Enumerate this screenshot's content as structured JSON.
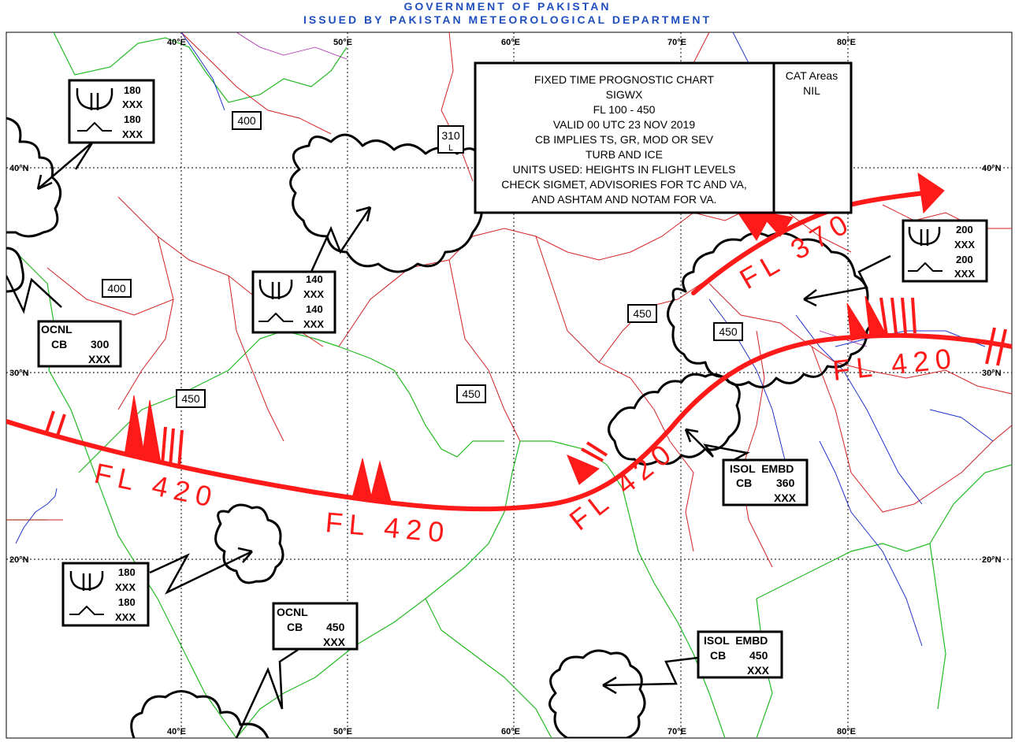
{
  "header": {
    "line1": "GOVERNMENT OF PAKISTAN",
    "line2": "ISSUED BY PAKISTAN METEOROLOGICAL DEPARTMENT"
  },
  "info_box": {
    "lines": [
      "FIXED TIME PROGNOSTIC CHART",
      "SIGWX",
      "FL 100 - 450",
      "VALID 00 UTC 23 NOV 2019",
      "CB IMPLIES TS, GR, MOD OR SEV",
      "TURB AND ICE",
      "UNITS USED: HEIGHTS IN FLIGHT LEVELS",
      "CHECK SIGMET, ADVISORIES FOR TC AND VA,",
      "AND ASHTAM AND NOTAM FOR VA."
    ]
  },
  "cat_box": {
    "title": "CAT Areas",
    "value": "NIL"
  },
  "graticule": {
    "lon_labels_top": [
      "40°E",
      "50°E",
      "60°E",
      "70°E",
      "80°E"
    ],
    "lon_labels_bottom": [
      "40°E",
      "50°E",
      "60°E",
      "70°E",
      "80°E"
    ],
    "lat_labels_left": [
      "40°N",
      "30°N",
      "20°N"
    ],
    "lat_labels_right": [
      "40°N",
      "30°N",
      "20°N"
    ]
  },
  "tropopause_heights": [
    "400",
    "310",
    "400",
    "450",
    "450",
    "450",
    "450"
  ],
  "tropopause_low_marker": "L",
  "jet_streams": [
    {
      "label": "FL 420"
    },
    {
      "label": "FL 420"
    },
    {
      "label": "FL 420"
    },
    {
      "label": "FL 420"
    },
    {
      "label": "FL 370"
    }
  ],
  "icing_turb_boxes": [
    {
      "turb_top": "180",
      "turb_base": "XXX",
      "ice_top": "180",
      "ice_base": "XXX"
    },
    {
      "turb_top": "140",
      "turb_base": "XXX",
      "ice_top": "140",
      "ice_base": "XXX"
    },
    {
      "turb_top": "180",
      "turb_base": "XXX",
      "ice_top": "180",
      "ice_base": "XXX"
    },
    {
      "turb_top": "200",
      "turb_base": "XXX",
      "ice_top": "200",
      "ice_base": "XXX"
    }
  ],
  "cb_boxes": [
    {
      "coverage": "OCNL",
      "type": "CB",
      "top": "300",
      "base": "XXX"
    },
    {
      "coverage": "ISOL  EMBD",
      "type": "CB",
      "top": "360",
      "base": "XXX"
    },
    {
      "coverage": "OCNL",
      "type": "CB",
      "top": "450",
      "base": "XXX"
    },
    {
      "coverage": "ISOL  EMBD",
      "type": "CB",
      "top": "450",
      "base": "XXX"
    }
  ],
  "colors": {
    "jet": "#ff1a1a",
    "border": "#d22222",
    "coast": "#22bb22",
    "river": "#2233cc",
    "header": "#1f4fbf",
    "province": "#aa22aa"
  }
}
